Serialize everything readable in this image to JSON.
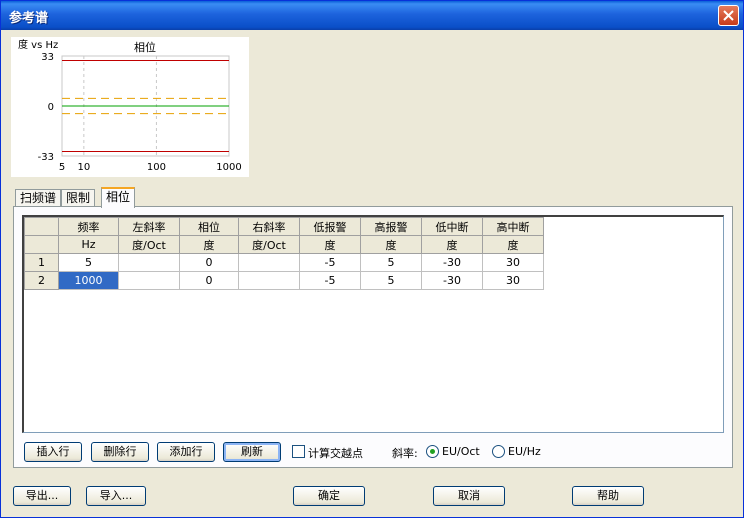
{
  "window": {
    "title": "参考谱"
  },
  "chart": {
    "title": "相位",
    "ylabel": "度 vs Hz",
    "colors": {
      "limit": "#c00000",
      "alarm": "#e8a000",
      "ref": "#00a000",
      "grid": "#c8c8c8"
    }
  },
  "chart_data": {
    "type": "line",
    "title": "相位",
    "ylabel": "度 vs Hz",
    "xscale": "log",
    "xlim": [
      5,
      1000
    ],
    "ylim": [
      -33,
      33
    ],
    "xticks": [
      "5",
      "10",
      "100",
      "1000"
    ],
    "yticks": [
      "33",
      "0",
      "-33"
    ],
    "x": [
      5,
      1000
    ],
    "series": [
      {
        "values": [
          30,
          30
        ],
        "style": "solid",
        "color": "#c00000"
      },
      {
        "values": [
          5,
          5
        ],
        "style": "dashed",
        "color": "#e8a000"
      },
      {
        "values": [
          0,
          0
        ],
        "style": "solid",
        "color": "#00a000"
      },
      {
        "values": [
          -5,
          -5
        ],
        "style": "dashed",
        "color": "#e8a000"
      },
      {
        "values": [
          -30,
          -30
        ],
        "style": "solid",
        "color": "#c00000"
      }
    ]
  },
  "tabs": [
    {
      "label": "扫频谱"
    },
    {
      "label": "限制"
    },
    {
      "label": "相位"
    }
  ],
  "table": {
    "columns": [
      {
        "name": "频率",
        "unit": "Hz"
      },
      {
        "name": "左斜率",
        "unit": "度/Oct"
      },
      {
        "name": "相位",
        "unit": "度"
      },
      {
        "name": "右斜率",
        "unit": "度/Oct"
      },
      {
        "name": "低报警",
        "unit": "度"
      },
      {
        "name": "高报警",
        "unit": "度"
      },
      {
        "name": "低中断",
        "unit": "度"
      },
      {
        "name": "高中断",
        "unit": "度"
      }
    ],
    "rows": [
      {
        "index": "1",
        "cells": [
          "5",
          "",
          "0",
          "",
          "-5",
          "5",
          "-30",
          "30"
        ]
      },
      {
        "index": "2",
        "cells": [
          "1000",
          "",
          "0",
          "",
          "-5",
          "5",
          "-30",
          "30"
        ]
      }
    ]
  },
  "panel_buttons": {
    "insert_row": "插入行",
    "delete_row": "删除行",
    "add_row": "添加行",
    "refresh": "刷新"
  },
  "compute_crossing": {
    "label": "计算交越点",
    "checked": false
  },
  "slope": {
    "label": "斜率:",
    "options": [
      {
        "label": "EU/Oct",
        "selected": true
      },
      {
        "label": "EU/Hz",
        "selected": false
      }
    ]
  },
  "footer_buttons": {
    "export": "导出...",
    "import": "导入...",
    "ok": "确定",
    "cancel": "取消",
    "help": "帮助"
  }
}
